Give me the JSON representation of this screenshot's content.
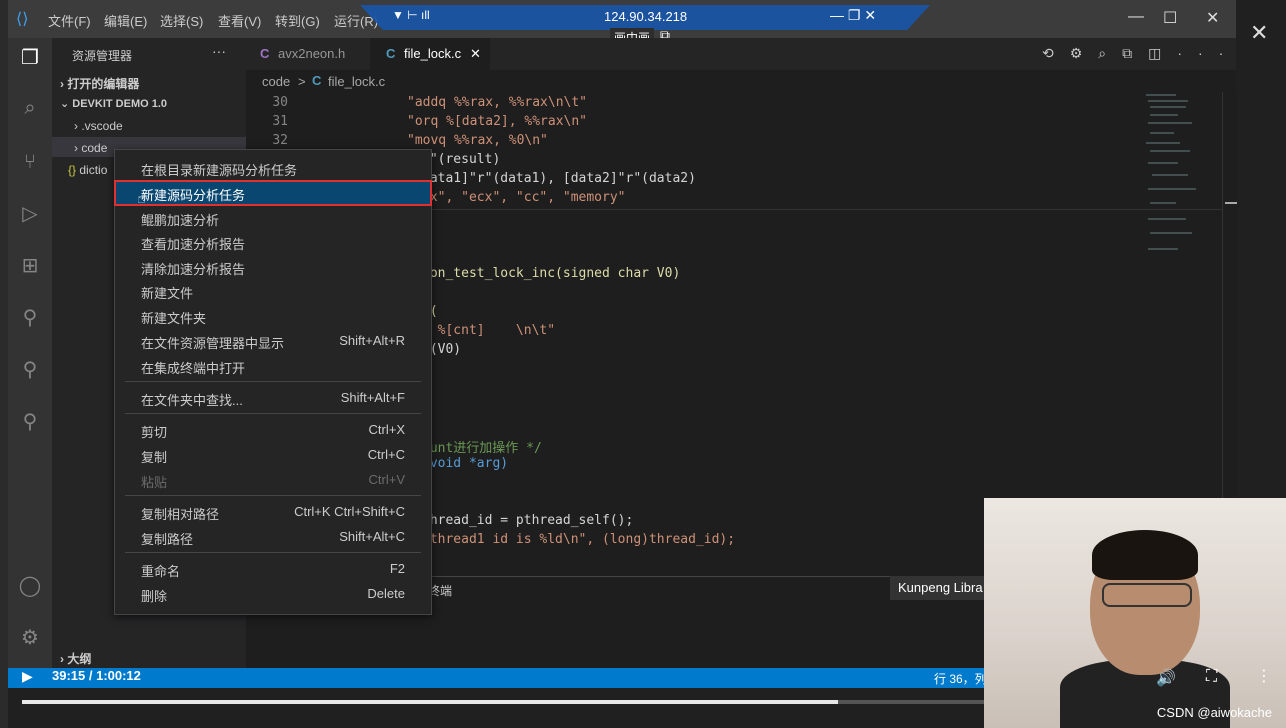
{
  "titlebar": {
    "menus": [
      "文件(F)",
      "编辑(E)",
      "选择(S)",
      "查看(V)",
      "转到(G)",
      "运行(R)"
    ],
    "remote_ip": "124.90.34.218",
    "pip_label": "画中画"
  },
  "sidebar": {
    "header": "资源管理器",
    "open_editors": "打开的编辑器",
    "workspace": "DEVKIT DEMO 1.0",
    "items": [
      ".vscode",
      "code",
      "dictio"
    ],
    "outline": "大纲"
  },
  "tabs": [
    {
      "icon": "C",
      "label": "avx2neon.h"
    },
    {
      "icon": "C",
      "label": "file_lock.c"
    }
  ],
  "breadcrumb": {
    "folder": "code",
    "sep": ">",
    "file": "file_lock.c"
  },
  "editor": {
    "line_numbers": [
      "30",
      "31",
      "32"
    ],
    "lines": [
      "\"addq %%rax, %%rax\\n\\t\"",
      "\"orq %[data2], %%rax\\n\"",
      "\"movq %%rax, %0\\n\"",
      "r\"(result)",
      "data1]\"r\"(data1), [data2]\"r\"(data2)",
      "ax\", \"ecx\", \"cc\", \"memory\"",
      "ion_test_lock_inc(signed char V0)",
      "e(",
      "b %[cnt]    \\n\\t\"",
      "\"(V0)",
      "ount进行加操作 */",
      "(void *arg)",
      "thread_id = pthread_self();",
      " thread1 id is %ld\\n\", (long)thread_id);"
    ]
  },
  "panel": {
    "tab_fragment": "终端",
    "kunpeng": "Kunpeng Libra"
  },
  "context_menu": {
    "items": [
      {
        "label": "在根目录新建源码分析任务",
        "key": ""
      },
      {
        "label": "新建源码分析任务",
        "key": ""
      },
      {
        "label": "鲲鹏加速分析",
        "key": ""
      },
      {
        "label": "查看加速分析报告",
        "key": ""
      },
      {
        "label": "清除加速分析报告",
        "key": ""
      },
      {
        "label": "新建文件",
        "key": ""
      },
      {
        "label": "新建文件夹",
        "key": ""
      },
      {
        "label": "在文件资源管理器中显示",
        "key": "Shift+Alt+R"
      },
      {
        "label": "在集成终端中打开",
        "key": ""
      },
      {
        "label": "在文件夹中查找...",
        "key": "Shift+Alt+F"
      },
      {
        "label": "剪切",
        "key": "Ctrl+X"
      },
      {
        "label": "复制",
        "key": "Ctrl+C"
      },
      {
        "label": "粘贴",
        "key": "Ctrl+V"
      },
      {
        "label": "复制相对路径",
        "key": "Ctrl+K Ctrl+Shift+C"
      },
      {
        "label": "复制路径",
        "key": "Shift+Alt+C"
      },
      {
        "label": "重命名",
        "key": "F2"
      },
      {
        "label": "删除",
        "key": "Delete"
      }
    ]
  },
  "statusbar": {
    "position": "行 36，列"
  },
  "video": {
    "time": "39:15 / 1:00:12",
    "progress": 0.66,
    "watermark": "CSDN @aiwokache"
  },
  "colors": {
    "accent": "#007acc",
    "highlight": "#094771",
    "outline": "#e03030"
  }
}
